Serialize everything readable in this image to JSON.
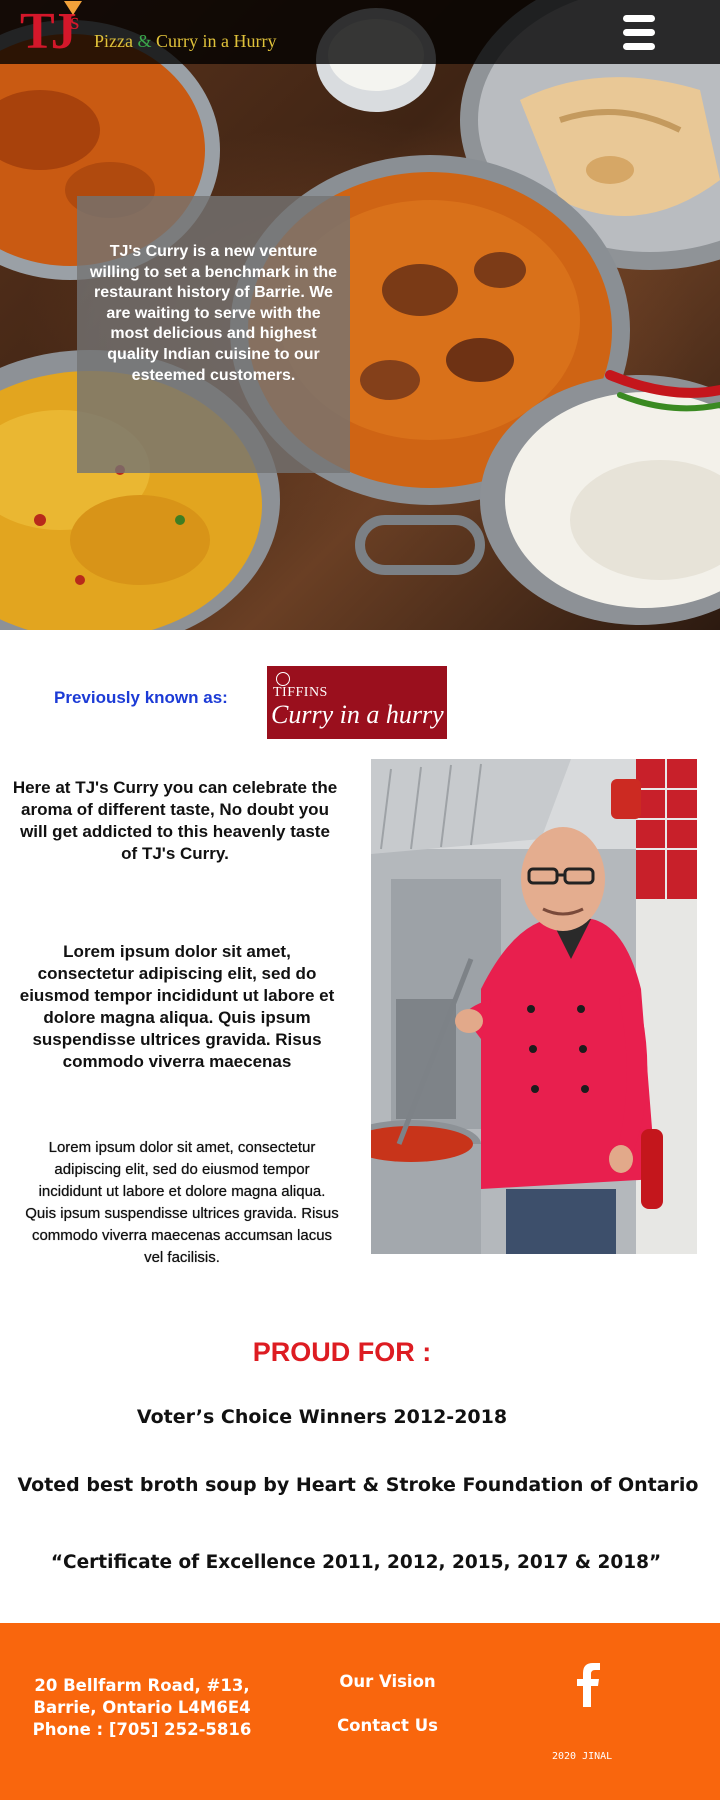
{
  "header": {
    "logo": {
      "letters": "TJ",
      "superscript": "s",
      "tagline_part1": "Pizza",
      "tagline_amp": "&",
      "tagline_part2": "Curry in a Hurry"
    },
    "menu_icon": "hamburger-menu-icon"
  },
  "hero": {
    "intro_text": "TJ's Curry is a new venture willing to set a benchmark in the restaurant history of Barrie. We are waiting to serve with the most delicious and highest quality Indian cuisine to our esteemed customers."
  },
  "previously": {
    "label": "Previously known as:",
    "logo_top": "TIFFINS",
    "logo_script": "Curry in a hurry"
  },
  "about": {
    "paragraph_1": "Here at TJ's Curry you can celebrate the aroma of different taste, No doubt you will get addicted to this heavenly taste of TJ's Curry.",
    "paragraph_2": "Lorem ipsum dolor sit amet, consectetur adipiscing elit, sed do eiusmod tempor incididunt ut labore et dolore magna aliqua. Quis ipsum suspendisse ultrices gravida. Risus commodo viverra maecenas",
    "paragraph_3": "Lorem ipsum dolor sit amet, consectetur adipiscing elit, sed do eiusmod tempor incididunt ut labore et dolore magna aliqua. Quis ipsum suspendisse ultrices gravida. Risus commodo viverra maecenas accumsan lacus vel facilisis."
  },
  "proud": {
    "heading": "PROUD FOR :",
    "awards": [
      "Voter’s Choice Winners 2012-2018",
      "Voted best broth soup by Heart & Stroke Foundation of Ontario",
      "“Certificate of Excellence 2011, 2012, 2015, 2017 & 2018”"
    ]
  },
  "footer": {
    "address_line1": "20 Bellfarm Road, #13,",
    "address_line2": "Barrie, Ontario L4M6E4",
    "phone": "Phone : [705] 252-5816",
    "links": [
      "Our Vision",
      "Contact Us"
    ],
    "social_icon": "facebook-icon",
    "copyright": "2020 JINAL"
  },
  "colors": {
    "footer_bg": "#f9660d",
    "accent_red": "#dd1c22",
    "label_blue": "#1c3bd6",
    "logo_red": "#d4172a",
    "tagline_gold": "#e0c23a"
  }
}
